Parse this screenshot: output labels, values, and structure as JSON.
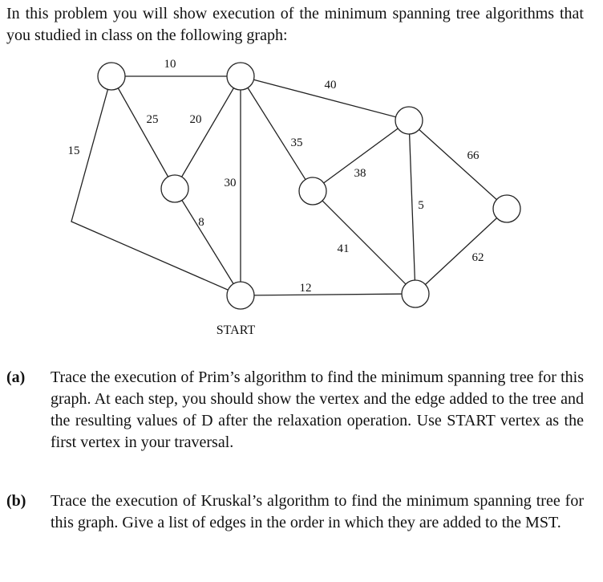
{
  "intro": "In this problem you will show execution of the minimum spanning tree algorithms that you studied in class on the following graph:",
  "graph": {
    "start_label": "START",
    "nodes": [
      {
        "id": "A"
      },
      {
        "id": "B"
      },
      {
        "id": "C"
      },
      {
        "id": "D"
      },
      {
        "id": "E"
      },
      {
        "id": "F"
      },
      {
        "id": "S",
        "label": "START"
      },
      {
        "id": "G"
      }
    ],
    "edges": [
      {
        "from": "A",
        "to": "B",
        "weight": "10"
      },
      {
        "from": "A",
        "to": "S",
        "weight": "15"
      },
      {
        "from": "A",
        "to": "C",
        "weight": "25"
      },
      {
        "from": "B",
        "to": "C",
        "weight": "20"
      },
      {
        "from": "B",
        "to": "S",
        "weight": "30"
      },
      {
        "from": "B",
        "to": "D",
        "weight": "35"
      },
      {
        "from": "B",
        "to": "E",
        "weight": "40"
      },
      {
        "from": "C",
        "to": "S",
        "weight": "8"
      },
      {
        "from": "D",
        "to": "E",
        "weight": "38"
      },
      {
        "from": "D",
        "to": "G",
        "weight": "41"
      },
      {
        "from": "E",
        "to": "G",
        "weight": "5"
      },
      {
        "from": "E",
        "to": "F",
        "weight": "66"
      },
      {
        "from": "F",
        "to": "G",
        "weight": "62"
      },
      {
        "from": "S",
        "to": "G",
        "weight": "12"
      }
    ]
  },
  "parts": [
    {
      "label": "(a)",
      "text": "Trace the execution of Prim’s algorithm to find the minimum spanning tree for this graph. At each step, you should show the vertex and the edge added to the tree and the resulting values of D after the relaxation operation. Use START vertex as the first vertex in your traversal."
    },
    {
      "label": "(b)",
      "text": "Trace the execution of Kruskal’s algorithm to find the minimum spanning tree for this graph. Give a list of edges in the order in which they are added to the MST."
    }
  ]
}
